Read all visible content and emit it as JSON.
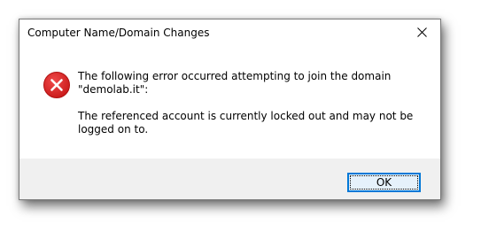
{
  "window": {
    "title": "Computer Name/Domain Changes",
    "close_icon": "close-icon"
  },
  "message": {
    "icon": "error-icon",
    "icon_color": "#e81123",
    "line1": "The following error occurred attempting to join the domain \"demolab.it\":",
    "line2": "The referenced account is currently locked out and may not be logged on to."
  },
  "footer": {
    "ok_label": "OK",
    "accent": "#0078d7"
  }
}
